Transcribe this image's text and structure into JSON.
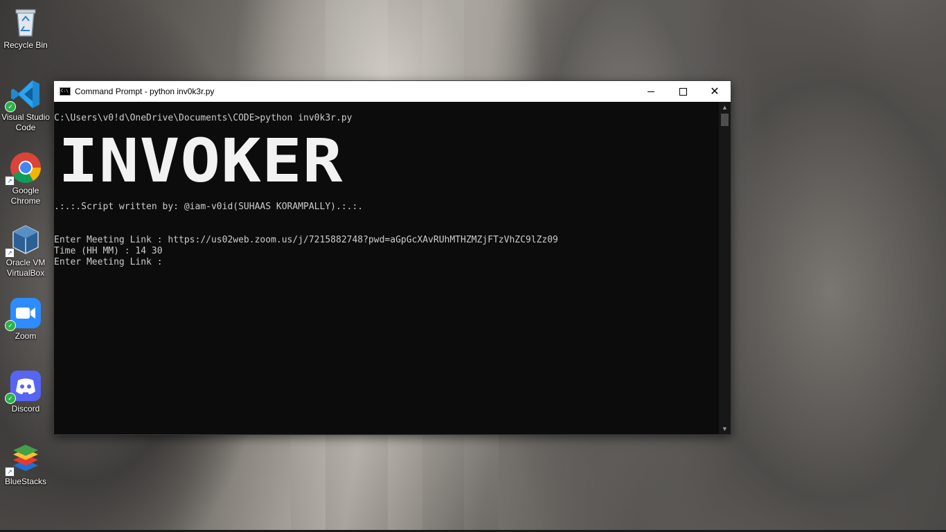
{
  "desktop": {
    "icons": [
      {
        "label_line1": "Recycle Bin",
        "label_line2": "",
        "icon": "recycle-bin-icon",
        "badge": ""
      },
      {
        "label_line1": "Visual Studio",
        "label_line2": "Code",
        "icon": "vscode-icon",
        "badge": "check"
      },
      {
        "label_line1": "Google",
        "label_line2": "Chrome",
        "icon": "chrome-icon",
        "badge": "shortcut"
      },
      {
        "label_line1": "Oracle VM",
        "label_line2": "VirtualBox",
        "icon": "virtualbox-icon",
        "badge": "shortcut"
      },
      {
        "label_line1": "Zoom",
        "label_line2": "",
        "icon": "zoom-icon",
        "badge": "check"
      },
      {
        "label_line1": "Discord",
        "label_line2": "",
        "icon": "discord-icon",
        "badge": "check"
      },
      {
        "label_line1": "BlueStacks",
        "label_line2": "",
        "icon": "bluestacks-icon",
        "badge": "shortcut"
      }
    ]
  },
  "window": {
    "title": "Command Prompt - python  inv0k3r.py",
    "icon_text": "C:\\",
    "buttons": {
      "minimize": "minimize-icon",
      "maximize": "maximize-icon",
      "close": "close-icon"
    }
  },
  "console": {
    "prompt_line": "C:\\Users\\v0!d\\OneDrive\\Documents\\CODE>python inv0k3r.py",
    "banner": "INVOKER",
    "credit_line": ".:.:.Script written by: @iam-v0id(SUHAAS KORAMPALLY).:.:.",
    "link_line": "Enter Meeting Link : https://us02web.zoom.us/j/7215882748?pwd=aGpGcXAvRUhMTHZMZjFTzVhZC9lZz09",
    "time_line": "Time (HH MM) : 14 30",
    "link_prompt_line": "Enter Meeting Link :"
  },
  "colors": {
    "console_bg": "#0c0c0c",
    "console_text": "#cccccc",
    "titlebar_bg": "#ffffff"
  }
}
